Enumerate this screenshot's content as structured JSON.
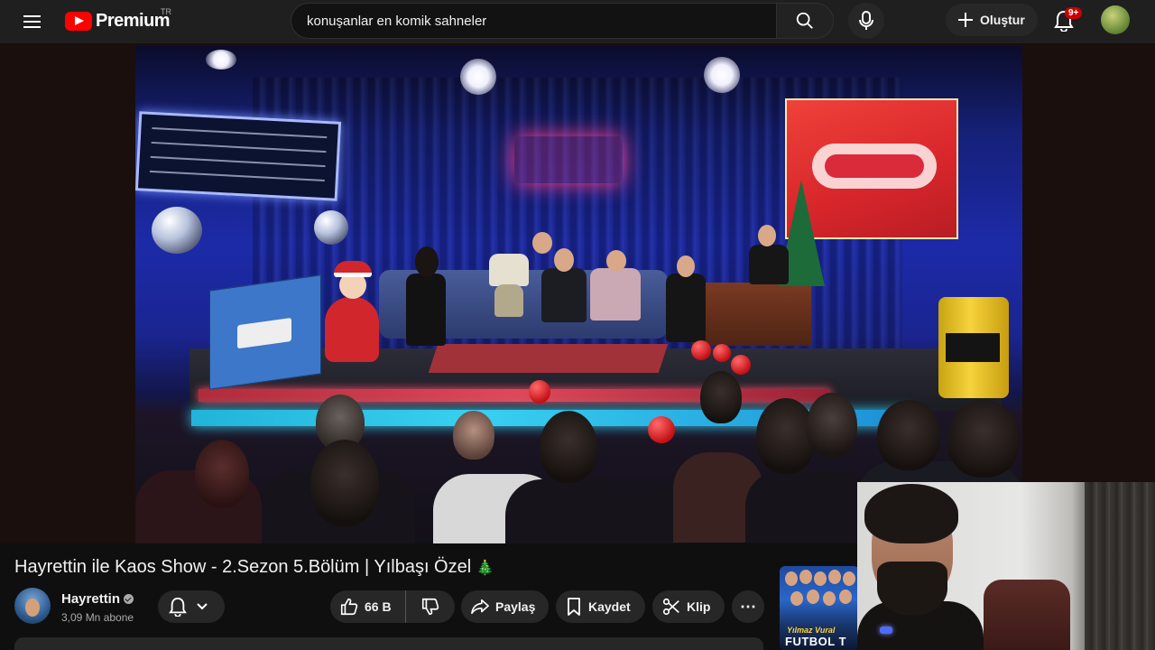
{
  "topbar": {
    "logo_text": "Premium",
    "country_code": "TR",
    "search_value": "konuşanlar en komik sahneler",
    "create_label": "Oluştur",
    "notifications_badge": "9+"
  },
  "video": {
    "title": "Hayrettin ile Kaos Show - 2.Sezon 5.Bölüm | Yılbaşı Özel",
    "title_emoji": "🎄"
  },
  "channel": {
    "name": "Hayrettin",
    "subscribers": "3,09 Mn abone"
  },
  "actions": {
    "like_count": "66 B",
    "share_label": "Paylaş",
    "save_label": "Kaydet",
    "clip_label": "Klip",
    "more_label": "⋯"
  },
  "side_thumbnail": {
    "subtitle": "Yılmaz Vural",
    "title": "FUTBOL T"
  },
  "colors": {
    "brand_red": "#ff0000",
    "badge_red": "#cc0000",
    "surface": "#272727",
    "background": "#0f0f0f"
  }
}
